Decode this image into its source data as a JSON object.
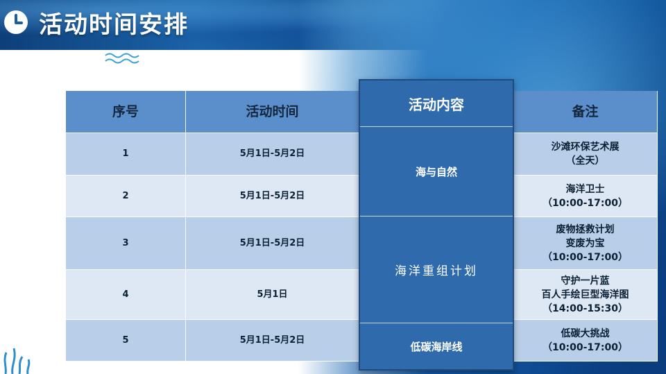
{
  "header": {
    "title": "活动时间安排"
  },
  "schedule": {
    "columns": [
      "序号",
      "活动时间",
      "活动内容",
      "备注"
    ],
    "rows": [
      {
        "no": "1",
        "time": "5月1日-5月2日",
        "note": [
          "沙滩环保艺术展",
          "（全天）"
        ]
      },
      {
        "no": "2",
        "time": "5月1日-5月2日",
        "note": [
          "海洋卫士",
          "（10:00-17:00）"
        ]
      },
      {
        "no": "3",
        "time": "5月1日-5月2日",
        "note": [
          "废物拯救计划",
          "变废为宝",
          "（10:00-17:00）"
        ]
      },
      {
        "no": "4",
        "time": "5月1日",
        "note": [
          "守护一片蓝",
          "百人手绘巨型海洋图",
          "（14:00-15:30）"
        ]
      },
      {
        "no": "5",
        "time": "5月1日-5月2日",
        "note": [
          "低碳大挑战",
          "（10:00-17:00）"
        ]
      }
    ],
    "content_groups": [
      "海与自然",
      "海洋重组计划",
      "低碳海岸线"
    ]
  },
  "colors": {
    "header_cell": "#5b8fcb",
    "row_dark": "#b9cfe9",
    "row_light": "#dde8f4",
    "content_column": "#2f6aac"
  },
  "icons": {
    "title_icon": "clock-icon",
    "decor_top": "wave-icon",
    "decor_bottom": "seaweed-icon"
  }
}
